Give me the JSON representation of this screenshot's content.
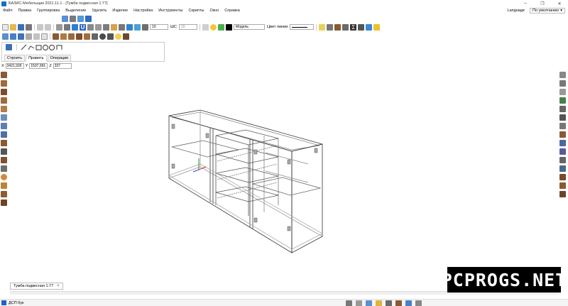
{
  "window": {
    "title": "БАЗИС-Мебельщик 2021.11.1 - [Тумба подвесная 1:77]"
  },
  "menu": {
    "items": [
      "Файл",
      "Правка",
      "Группировка",
      "Выделение",
      "Удалить",
      "Изделие",
      "Настройка",
      "Инструменты",
      "Скрипты",
      "Окно",
      "Справка"
    ],
    "language": "Language",
    "preset": "По умолчанию"
  },
  "toolbar": {
    "zoom_value": "10",
    "step_label": "ШС",
    "step_value": "10",
    "layer_value": "Модель",
    "line_color_label": "Цвет линии"
  },
  "palette": {
    "tabs": [
      "Строить",
      "Править",
      "Операции"
    ],
    "active_tab": "Править"
  },
  "coords": {
    "x_label": "X",
    "x_value": "3421,926",
    "y_label": "Y",
    "y_value": "1537,991",
    "z_label": "Z",
    "z_value": "337"
  },
  "document": {
    "tab_label": "Тумба подвесная 1:77"
  },
  "status": {
    "material": "ДСП бук"
  },
  "watermark": {
    "text": "PCPROGS.NET"
  },
  "colors": {
    "accent": "#1b6ec2",
    "model_line": "#333333",
    "wood": "#8a5a34"
  }
}
